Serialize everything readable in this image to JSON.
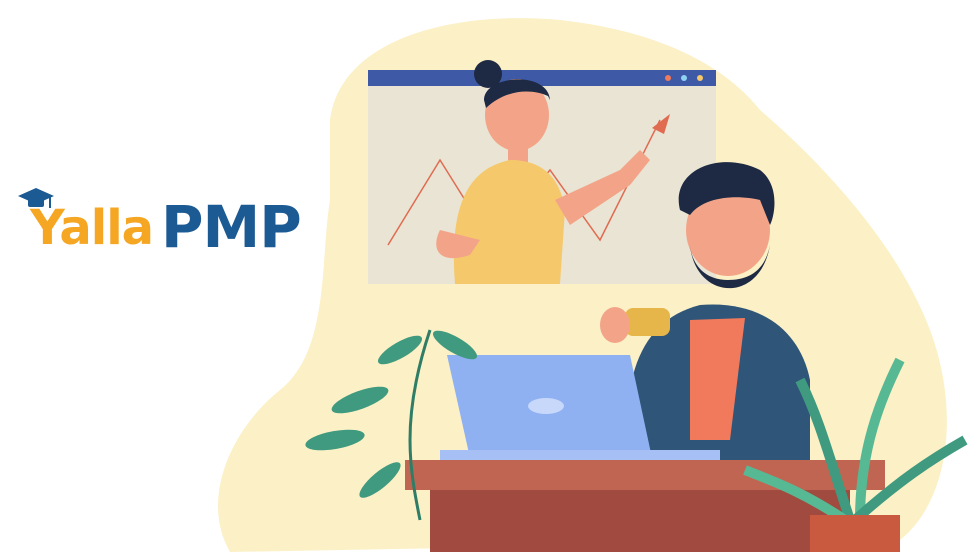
{
  "logo": {
    "part1": "Yalla",
    "part2": "PMP",
    "icon": "graduation-cap-icon"
  },
  "colors": {
    "logo_orange": "#f5a623",
    "logo_blue": "#1c5a93",
    "blob": "#fbf0c6",
    "window_bar": "#3e5aa6",
    "window_bg": "#e9e4d3",
    "laptop": "#8fb1f2",
    "desk": "#a14a3f",
    "plant": "#3f9a7f",
    "shirt": "#f07a5b",
    "jacket": "#2f5578"
  },
  "illustration": {
    "scene": "video-call-illustration"
  }
}
